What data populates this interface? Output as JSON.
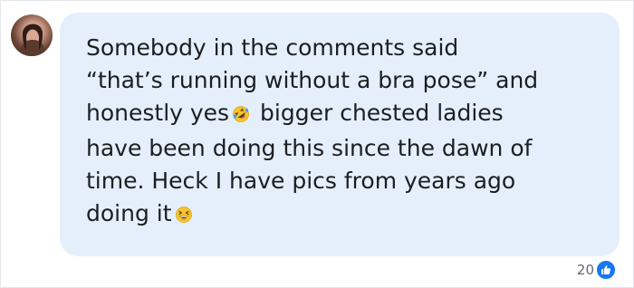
{
  "comment": {
    "lines": [
      "Somebody in the comments said",
      "“that’s running without a bra pose” and",
      "honestly yes",
      "bigger chested ladies",
      "have been doing this since the dawn of",
      "time. Heck I have pics from years ago",
      "doing it"
    ],
    "emojis": [
      "rolling-on-floor-laughing-icon",
      "grinning-squinting-face-icon"
    ]
  },
  "reactions": {
    "count": "20",
    "icon": "like-icon",
    "color": "#1877f2"
  },
  "colors": {
    "bubble": "#e4effb",
    "text": "#1c1e21",
    "meta": "#65676b"
  }
}
